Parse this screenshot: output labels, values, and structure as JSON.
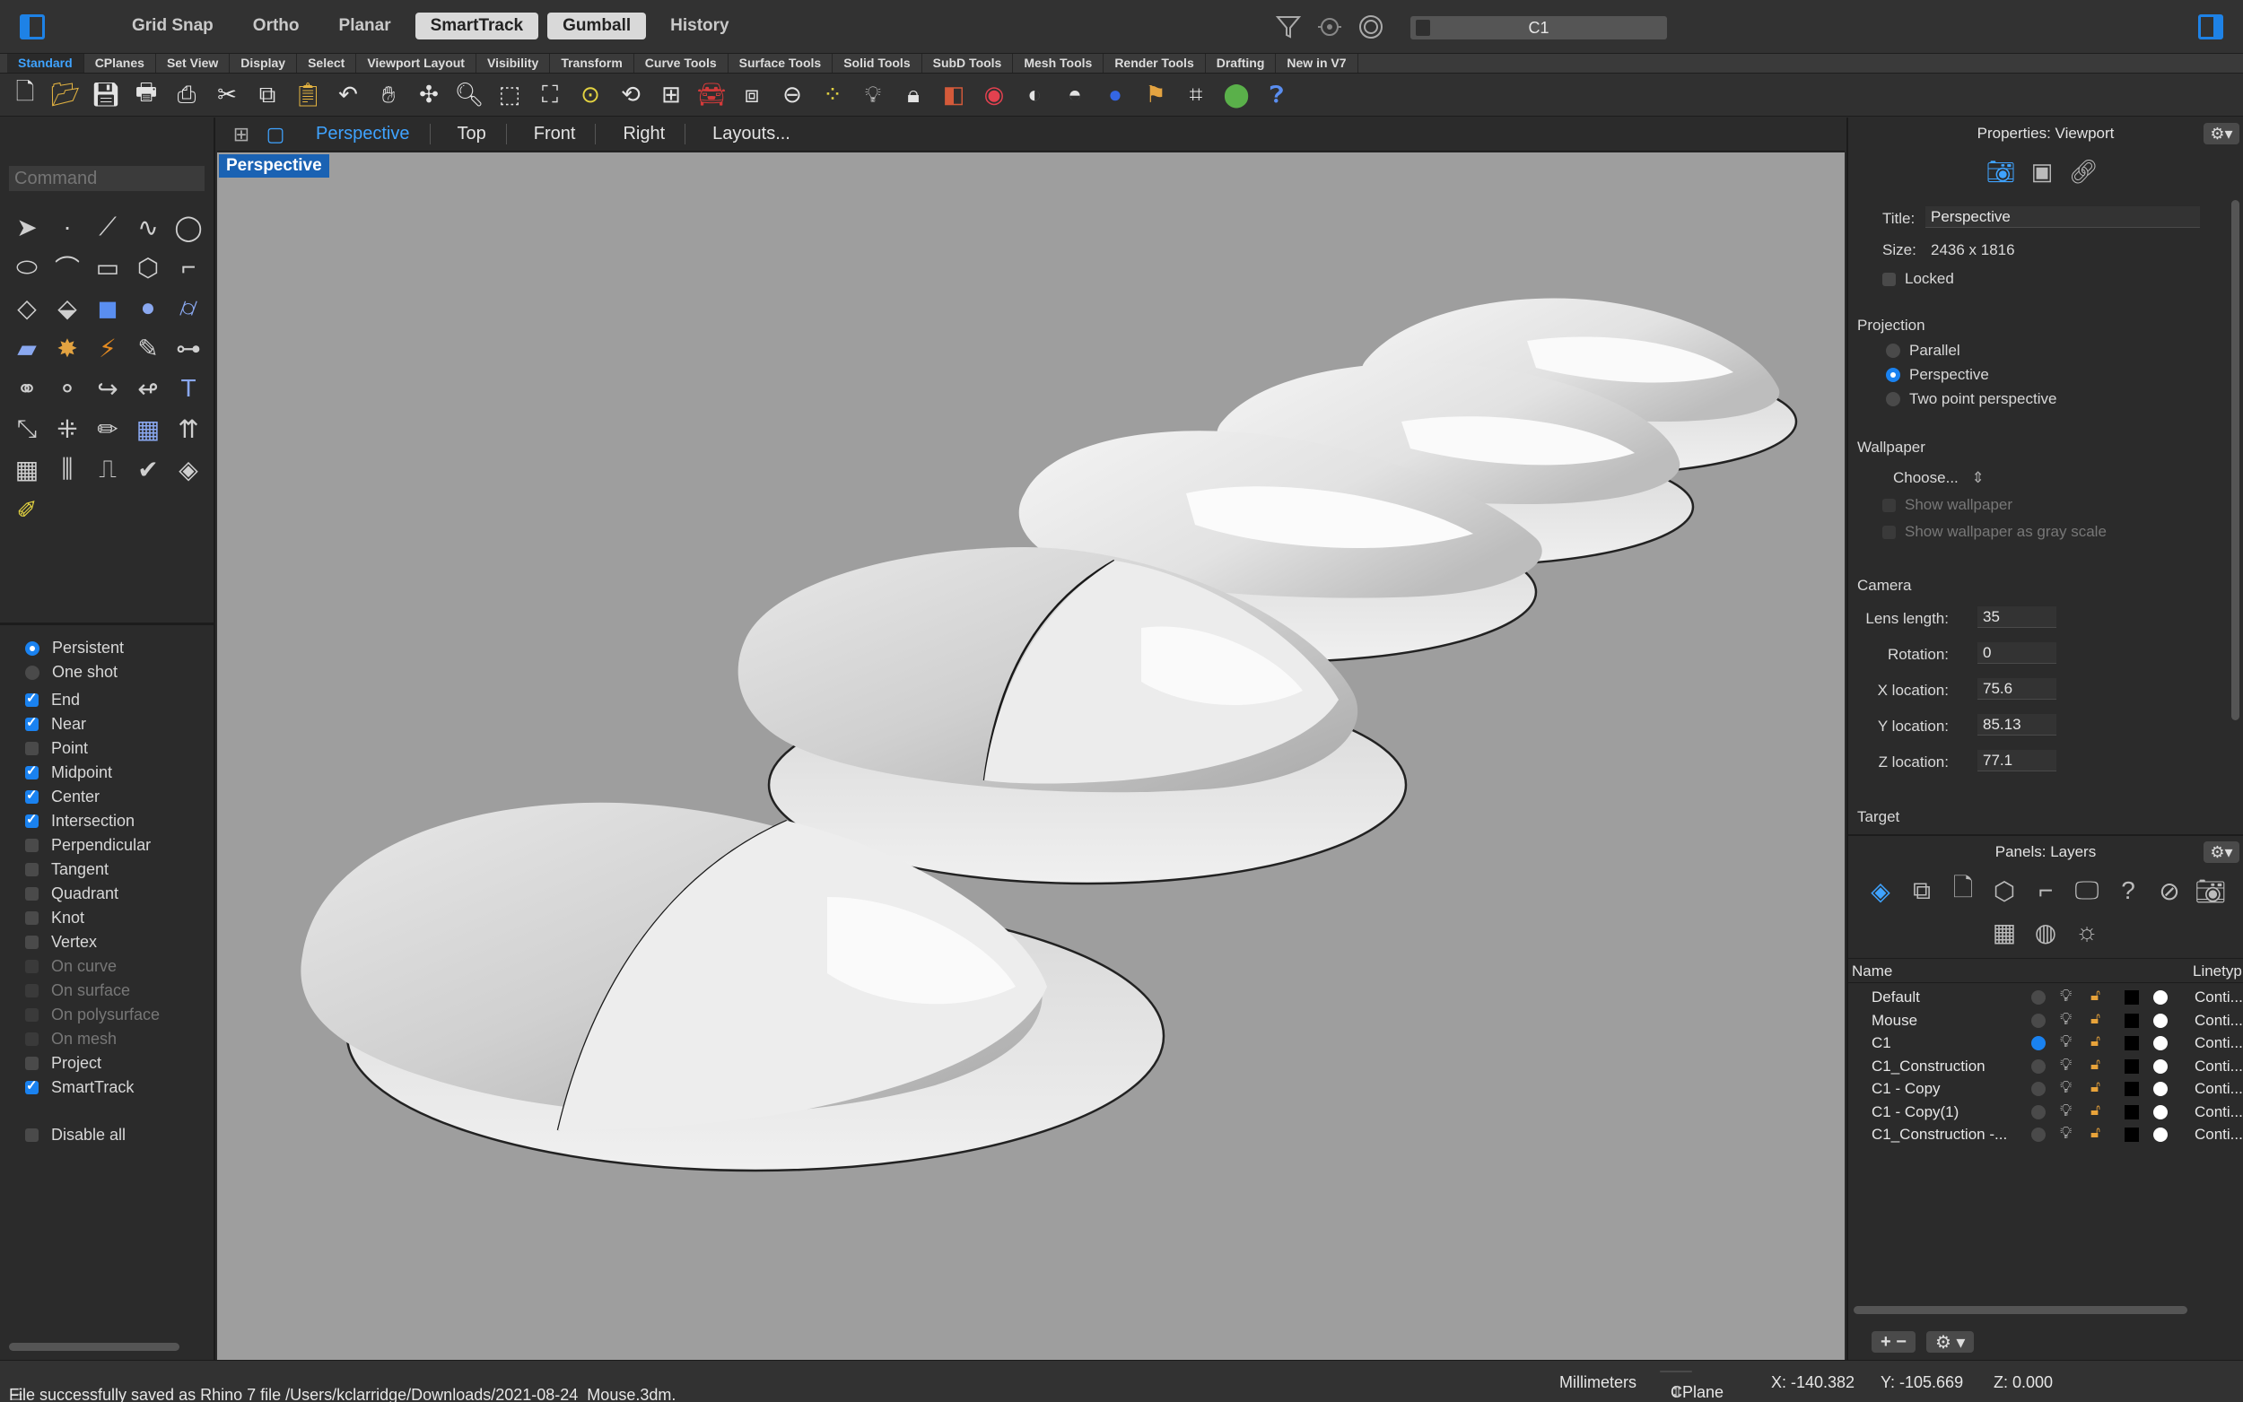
{
  "topbar": {
    "modes": [
      {
        "label": "Grid Snap",
        "on": false
      },
      {
        "label": "Ortho",
        "on": false
      },
      {
        "label": "Planar",
        "on": false
      },
      {
        "label": "SmartTrack",
        "on": true
      },
      {
        "label": "Gumball",
        "on": true
      },
      {
        "label": "History",
        "on": false
      }
    ],
    "current_layer": "C1",
    "icons": [
      "filter-icon",
      "osnap-target-icon",
      "record-icon"
    ]
  },
  "tabs": [
    "Standard",
    "CPlanes",
    "Set View",
    "Display",
    "Select",
    "Viewport Layout",
    "Visibility",
    "Transform",
    "Curve Tools",
    "Surface Tools",
    "Solid Tools",
    "SubD Tools",
    "Mesh Tools",
    "Render Tools",
    "Drafting",
    "New in V7"
  ],
  "active_tab": "Standard",
  "command": {
    "placeholder": "Command"
  },
  "osnap": {
    "modes": [
      {
        "label": "Persistent",
        "type": "radio",
        "checked": true,
        "enabled": true
      },
      {
        "label": "One shot",
        "type": "radio",
        "checked": false,
        "enabled": true
      }
    ],
    "items": [
      {
        "label": "End",
        "checked": true,
        "enabled": true
      },
      {
        "label": "Near",
        "checked": true,
        "enabled": true
      },
      {
        "label": "Point",
        "checked": false,
        "enabled": true
      },
      {
        "label": "Midpoint",
        "checked": true,
        "enabled": true
      },
      {
        "label": "Center",
        "checked": true,
        "enabled": true
      },
      {
        "label": "Intersection",
        "checked": true,
        "enabled": true
      },
      {
        "label": "Perpendicular",
        "checked": false,
        "enabled": true
      },
      {
        "label": "Tangent",
        "checked": false,
        "enabled": true
      },
      {
        "label": "Quadrant",
        "checked": false,
        "enabled": true
      },
      {
        "label": "Knot",
        "checked": false,
        "enabled": true
      },
      {
        "label": "Vertex",
        "checked": false,
        "enabled": true
      },
      {
        "label": "On curve",
        "checked": false,
        "enabled": false
      },
      {
        "label": "On surface",
        "checked": false,
        "enabled": false
      },
      {
        "label": "On polysurface",
        "checked": false,
        "enabled": false
      },
      {
        "label": "On mesh",
        "checked": false,
        "enabled": false
      },
      {
        "label": "Project",
        "checked": false,
        "enabled": true
      },
      {
        "label": "SmartTrack",
        "checked": true,
        "enabled": true
      }
    ],
    "disable_all": "Disable all"
  },
  "viewport": {
    "tabs": [
      "Perspective",
      "Top",
      "Front",
      "Right",
      "Layouts..."
    ],
    "active": "Perspective",
    "label": "Perspective"
  },
  "properties": {
    "title": "Properties: Viewport",
    "title_label": "Title:",
    "title_value": "Perspective",
    "size_label": "Size:",
    "size_value": "2436 x 1816",
    "locked": "Locked",
    "projection_head": "Projection",
    "projection": [
      {
        "label": "Parallel",
        "checked": false
      },
      {
        "label": "Perspective",
        "checked": true
      },
      {
        "label": "Two point perspective",
        "checked": false
      }
    ],
    "wallpaper_head": "Wallpaper",
    "wallpaper_choose": "Choose...",
    "show_wallpaper": "Show wallpaper",
    "show_gray": "Show wallpaper as gray scale",
    "camera_head": "Camera",
    "camera": [
      {
        "label": "Lens length:",
        "value": "35"
      },
      {
        "label": "Rotation:",
        "value": "0"
      },
      {
        "label": "X location:",
        "value": "75.6"
      },
      {
        "label": "Y location:",
        "value": "85.13"
      },
      {
        "label": "Z location:",
        "value": "77.1"
      }
    ],
    "target_head": "Target"
  },
  "layers": {
    "title": "Panels: Layers",
    "col_name": "Name",
    "col_linetype": "Linetyp",
    "rows": [
      {
        "name": "Default",
        "current": false,
        "linetype": "Conti..."
      },
      {
        "name": "Mouse",
        "current": false,
        "linetype": "Conti..."
      },
      {
        "name": "C1",
        "current": true,
        "linetype": "Conti..."
      },
      {
        "name": "C1_Construction",
        "current": false,
        "linetype": "Conti..."
      },
      {
        "name": "C1 - Copy",
        "current": false,
        "linetype": "Conti..."
      },
      {
        "name": "C1 - Copy(1)",
        "current": false,
        "linetype": "Conti..."
      },
      {
        "name": "C1_Construction -...",
        "current": false,
        "linetype": "Conti..."
      }
    ],
    "add": "+",
    "remove": "−"
  },
  "status": {
    "message": "File successfully saved as Rhino 7 file /Users/kclarridge/Downloads/2021-08-24_Mouse.3dm.",
    "units": "Millimeters",
    "cplane": "CPlane",
    "x": "X: -140.382",
    "y": "Y: -105.669",
    "z": "Z: 0.000"
  }
}
